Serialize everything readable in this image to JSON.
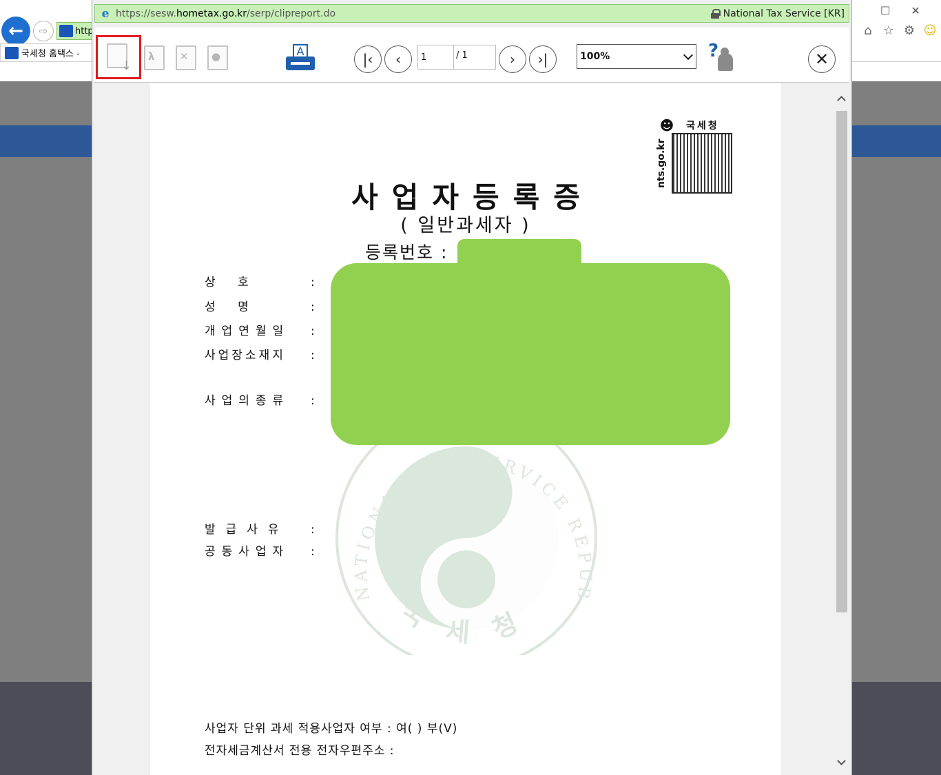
{
  "background": {
    "address_text": "http",
    "tab_title": "국세청 홈택스 -"
  },
  "popup": {
    "url_prefix": "https://sesw.",
    "url_domain": "hometax.go.kr",
    "url_path": "/serp/clipreport.do",
    "site_identity": "National Tax Service [KR]",
    "toolbar": {
      "print_glyph": "A",
      "current_page": "1",
      "total_pages": "/ 1",
      "zoom": "100%",
      "help_glyph": "?"
    },
    "certificate": {
      "nts_logo_name": "국세청",
      "nts_site": "nts.go.kr",
      "title": "사업자등록증",
      "subtitle": "( 일반과세자 )",
      "reg_number_label": "등록번호 :",
      "fields": {
        "trade_name": "상      호",
        "representative": "성      명",
        "opening_date": "개업연월일",
        "business_address": "사업장소재지",
        "business_type": "사업의종류",
        "issue_reason": "발급사유",
        "joint_operator": "공동사업자"
      },
      "colon": ":",
      "unit_taxation": "사업자 단위 과세 적용사업자 여부  :  여(   ) 부(V)",
      "e_invoice_email": "전자세금계산서 전용 전자우편주소  :",
      "seal": {
        "top_text": "NATIONAL TAX SERVICE REPUBLIC OF KOREA",
        "bottom_text": "국 세 청"
      }
    }
  },
  "colors": {
    "redaction": "#92d050",
    "highlight_box": "#e01b1b",
    "address_bar": "#c8f0b7",
    "brand_blue": "#1f5fae"
  }
}
